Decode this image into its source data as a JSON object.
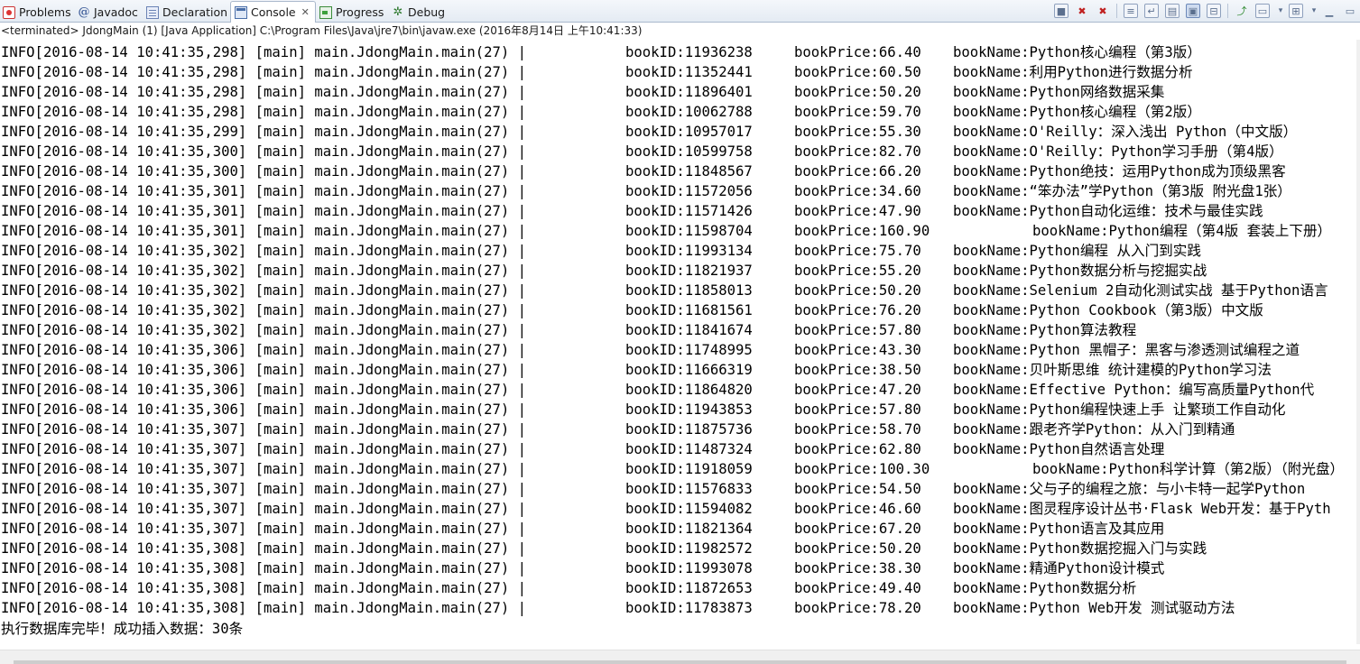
{
  "tabs": [
    {
      "label": "Problems",
      "icon": "problems-icon"
    },
    {
      "label": "Javadoc",
      "icon": "javadoc-icon"
    },
    {
      "label": "Declaration",
      "icon": "declaration-icon"
    },
    {
      "label": "Console",
      "icon": "console-icon",
      "active": true
    },
    {
      "label": "Progress",
      "icon": "progress-icon"
    },
    {
      "label": "Debug",
      "icon": "debug-icon"
    }
  ],
  "status_line": "<terminated> JdongMain (1) [Java Application] C:\\Program Files\\Java\\jre7\\bin\\javaw.exe (2016年8月14日 上午10:41:33)",
  "log_lines": [
    {
      "prefix": "INFO[2016-08-14 10:41:35,298] [main] main.JdongMain.main(27) |",
      "id": "bookID:11936238",
      "price": "bookPrice:66.40",
      "name": "bookName:Python核心编程（第3版）"
    },
    {
      "prefix": "INFO[2016-08-14 10:41:35,298] [main] main.JdongMain.main(27) |",
      "id": "bookID:11352441",
      "price": "bookPrice:60.50",
      "name": "bookName:利用Python进行数据分析"
    },
    {
      "prefix": "INFO[2016-08-14 10:41:35,298] [main] main.JdongMain.main(27) |",
      "id": "bookID:11896401",
      "price": "bookPrice:50.20",
      "name": "bookName:Python网络数据采集"
    },
    {
      "prefix": "INFO[2016-08-14 10:41:35,298] [main] main.JdongMain.main(27) |",
      "id": "bookID:10062788",
      "price": "bookPrice:59.70",
      "name": "bookName:Python核心编程（第2版）"
    },
    {
      "prefix": "INFO[2016-08-14 10:41:35,299] [main] main.JdongMain.main(27) |",
      "id": "bookID:10957017",
      "price": "bookPrice:55.30",
      "name": "bookName:O'Reilly：深入浅出 Python（中文版）"
    },
    {
      "prefix": "INFO[2016-08-14 10:41:35,300] [main] main.JdongMain.main(27) |",
      "id": "bookID:10599758",
      "price": "bookPrice:82.70",
      "name": "bookName:O'Reilly：Python学习手册（第4版）"
    },
    {
      "prefix": "INFO[2016-08-14 10:41:35,300] [main] main.JdongMain.main(27) |",
      "id": "bookID:11848567",
      "price": "bookPrice:66.20",
      "name": "bookName:Python绝技：运用Python成为顶级黑客"
    },
    {
      "prefix": "INFO[2016-08-14 10:41:35,301] [main] main.JdongMain.main(27) |",
      "id": "bookID:11572056",
      "price": "bookPrice:34.60",
      "name": "bookName:“笨办法”学Python（第3版 附光盘1张）"
    },
    {
      "prefix": "INFO[2016-08-14 10:41:35,301] [main] main.JdongMain.main(27) |",
      "id": "bookID:11571426",
      "price": "bookPrice:47.90",
      "name": "bookName:Python自动化运维：技术与最佳实践"
    },
    {
      "prefix": "INFO[2016-08-14 10:41:35,301] [main] main.JdongMain.main(27) |",
      "id": "bookID:11598704",
      "price": "bookPrice:160.90",
      "name": "bookName:Python编程（第4版 套装上下册）",
      "wide": true
    },
    {
      "prefix": "INFO[2016-08-14 10:41:35,302] [main] main.JdongMain.main(27) |",
      "id": "bookID:11993134",
      "price": "bookPrice:75.70",
      "name": "bookName:Python编程 从入门到实践"
    },
    {
      "prefix": "INFO[2016-08-14 10:41:35,302] [main] main.JdongMain.main(27) |",
      "id": "bookID:11821937",
      "price": "bookPrice:55.20",
      "name": "bookName:Python数据分析与挖掘实战"
    },
    {
      "prefix": "INFO[2016-08-14 10:41:35,302] [main] main.JdongMain.main(27) |",
      "id": "bookID:11858013",
      "price": "bookPrice:50.20",
      "name": "bookName:Selenium 2自动化测试实战 基于Python语言"
    },
    {
      "prefix": "INFO[2016-08-14 10:41:35,302] [main] main.JdongMain.main(27) |",
      "id": "bookID:11681561",
      "price": "bookPrice:76.20",
      "name": "bookName:Python Cookbook（第3版）中文版"
    },
    {
      "prefix": "INFO[2016-08-14 10:41:35,302] [main] main.JdongMain.main(27) |",
      "id": "bookID:11841674",
      "price": "bookPrice:57.80",
      "name": "bookName:Python算法教程"
    },
    {
      "prefix": "INFO[2016-08-14 10:41:35,306] [main] main.JdongMain.main(27) |",
      "id": "bookID:11748995",
      "price": "bookPrice:43.30",
      "name": "bookName:Python 黑帽子：黑客与渗透测试编程之道"
    },
    {
      "prefix": "INFO[2016-08-14 10:41:35,306] [main] main.JdongMain.main(27) |",
      "id": "bookID:11666319",
      "price": "bookPrice:38.50",
      "name": "bookName:贝叶斯思维 统计建模的Python学习法"
    },
    {
      "prefix": "INFO[2016-08-14 10:41:35,306] [main] main.JdongMain.main(27) |",
      "id": "bookID:11864820",
      "price": "bookPrice:47.20",
      "name": "bookName:Effective Python：编写高质量Python代"
    },
    {
      "prefix": "INFO[2016-08-14 10:41:35,306] [main] main.JdongMain.main(27) |",
      "id": "bookID:11943853",
      "price": "bookPrice:57.80",
      "name": "bookName:Python编程快速上手 让繁琐工作自动化"
    },
    {
      "prefix": "INFO[2016-08-14 10:41:35,307] [main] main.JdongMain.main(27) |",
      "id": "bookID:11875736",
      "price": "bookPrice:58.70",
      "name": "bookName:跟老齐学Python：从入门到精通"
    },
    {
      "prefix": "INFO[2016-08-14 10:41:35,307] [main] main.JdongMain.main(27) |",
      "id": "bookID:11487324",
      "price": "bookPrice:62.80",
      "name": "bookName:Python自然语言处理"
    },
    {
      "prefix": "INFO[2016-08-14 10:41:35,307] [main] main.JdongMain.main(27) |",
      "id": "bookID:11918059",
      "price": "bookPrice:100.30",
      "name": "bookName:Python科学计算（第2版）（附光盘）",
      "wide": true
    },
    {
      "prefix": "INFO[2016-08-14 10:41:35,307] [main] main.JdongMain.main(27) |",
      "id": "bookID:11576833",
      "price": "bookPrice:54.50",
      "name": "bookName:父与子的编程之旅：与小卡特一起学Python"
    },
    {
      "prefix": "INFO[2016-08-14 10:41:35,307] [main] main.JdongMain.main(27) |",
      "id": "bookID:11594082",
      "price": "bookPrice:46.60",
      "name": "bookName:图灵程序设计丛书·Flask Web开发：基于Pyth"
    },
    {
      "prefix": "INFO[2016-08-14 10:41:35,307] [main] main.JdongMain.main(27) |",
      "id": "bookID:11821364",
      "price": "bookPrice:67.20",
      "name": "bookName:Python语言及其应用"
    },
    {
      "prefix": "INFO[2016-08-14 10:41:35,308] [main] main.JdongMain.main(27) |",
      "id": "bookID:11982572",
      "price": "bookPrice:50.20",
      "name": "bookName:Python数据挖掘入门与实践"
    },
    {
      "prefix": "INFO[2016-08-14 10:41:35,308] [main] main.JdongMain.main(27) |",
      "id": "bookID:11993078",
      "price": "bookPrice:38.30",
      "name": "bookName:精通Python设计模式"
    },
    {
      "prefix": "INFO[2016-08-14 10:41:35,308] [main] main.JdongMain.main(27) |",
      "id": "bookID:11872653",
      "price": "bookPrice:49.40",
      "name": "bookName:Python数据分析"
    },
    {
      "prefix": "INFO[2016-08-14 10:41:35,308] [main] main.JdongMain.main(27) |",
      "id": "bookID:11783873",
      "price": "bookPrice:78.20",
      "name": "bookName:Python Web开发 测试驱动方法"
    }
  ],
  "summary_line": "执行数据库完毕！成功插入数据：30条",
  "toolbar_icons": [
    "terminate-icon",
    "remove-launch-icon",
    "remove-all-terminated-icon",
    "scroll-lock-icon",
    "word-wrap-icon",
    "show-on-stdout-icon",
    "show-on-stderr-icon",
    "pin-console-icon",
    "display-selected-console-icon",
    "open-console-icon",
    "minimize-icon",
    "maximize-icon"
  ]
}
